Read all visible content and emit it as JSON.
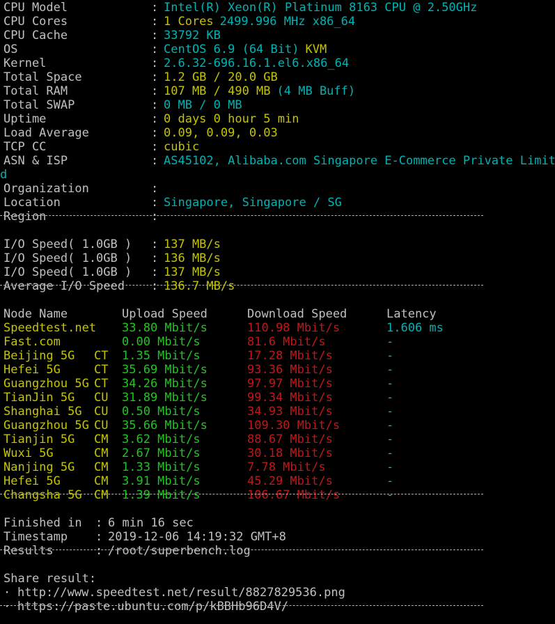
{
  "colors": {
    "background": "#000000",
    "label_text": "#c0c0c0",
    "cyan": "#00b3b3",
    "yellow": "#c4c400",
    "green": "#22c322",
    "red": "#c01818"
  },
  "system_info": [
    {
      "label": "CPU Model",
      "sep": ":",
      "value": "Intel(R) Xeon(R) Platinum 8163 CPU @ 2.50GHz",
      "color": "cy"
    },
    {
      "label": "CPU Cores",
      "sep": ":",
      "value": "1 Cores",
      "value2": "2499.996 MHz x86_64",
      "color": "yl",
      "color2": "cy"
    },
    {
      "label": "CPU Cache",
      "sep": ":",
      "value": "33792 KB",
      "color": "cy"
    },
    {
      "label": "OS",
      "sep": ":",
      "value": "CentOS 6.9 (64 Bit)",
      "value2": "KVM",
      "color": "cy",
      "color2": "yl"
    },
    {
      "label": "Kernel",
      "sep": ":",
      "value": "2.6.32-696.16.1.el6.x86_64",
      "color": "cy"
    },
    {
      "label": "Total Space",
      "sep": ":",
      "value": "1.2 GB / 20.0 GB",
      "color": "yl"
    },
    {
      "label": "Total RAM",
      "sep": ":",
      "value": "107 MB / 490 MB",
      "value2": "(4 MB Buff)",
      "color": "yl",
      "color2": "cy"
    },
    {
      "label": "Total SWAP",
      "sep": ":",
      "value": "0 MB / 0 MB",
      "color": "cy"
    },
    {
      "label": "Uptime",
      "sep": ":",
      "value": "0 days 0 hour 5 min",
      "color": "yl"
    },
    {
      "label": "Load Average",
      "sep": ":",
      "value": "0.09, 0.09, 0.03",
      "color": "yl"
    },
    {
      "label": "TCP CC",
      "sep": ":",
      "value": "cubic",
      "color": "yl"
    },
    {
      "label": "ASN & ISP",
      "sep": ":",
      "value": "AS45102, Alibaba.com Singapore E-Commerce Private Limite",
      "color": "cy"
    }
  ],
  "wrap_char": "d",
  "location_info": [
    {
      "label": "Organization",
      "sep": ":",
      "value": ""
    },
    {
      "label": "Location",
      "sep": ":",
      "value": "Singapore, Singapore / SG",
      "color": "cy"
    },
    {
      "label": "Region",
      "sep": ":",
      "value": ""
    }
  ],
  "io_speed": [
    {
      "label": "I/O Speed( 1.0GB )",
      "sep": ":",
      "value": "137 MB/s"
    },
    {
      "label": "I/O Speed( 1.0GB )",
      "sep": ":",
      "value": "136 MB/s"
    },
    {
      "label": "I/O Speed( 1.0GB )",
      "sep": ":",
      "value": "137 MB/s"
    },
    {
      "label": "Average I/O Speed",
      "sep": ":",
      "value": "136.7 MB/s"
    }
  ],
  "speed_table": {
    "headers": [
      "Node Name",
      "Upload Speed",
      "Download Speed",
      "Latency"
    ],
    "rows": [
      {
        "node": "Speedtest.net",
        "isp": "",
        "upload": "33.80 Mbit/s",
        "download": "110.98 Mbit/s",
        "latency": "1.606 ms",
        "node_color": "yl"
      },
      {
        "node": "Fast.com",
        "isp": "",
        "upload": "0.00 Mbit/s",
        "download": "81.6 Mbit/s",
        "latency": "-",
        "node_color": "yl"
      },
      {
        "node": "Beijing 5G",
        "isp": "CT",
        "upload": "1.35 Mbit/s",
        "download": "17.28 Mbit/s",
        "latency": "-",
        "node_color": "yl"
      },
      {
        "node": "Hefei 5G",
        "isp": "CT",
        "upload": "35.69 Mbit/s",
        "download": "93.36 Mbit/s",
        "latency": "-",
        "node_color": "yl"
      },
      {
        "node": "Guangzhou 5G",
        "isp": "CT",
        "upload": "34.26 Mbit/s",
        "download": "97.97 Mbit/s",
        "latency": "-",
        "node_color": "yl"
      },
      {
        "node": "TianJin 5G",
        "isp": "CU",
        "upload": "31.89 Mbit/s",
        "download": "99.34 Mbit/s",
        "latency": "-",
        "node_color": "yl"
      },
      {
        "node": "Shanghai 5G",
        "isp": "CU",
        "upload": "0.50 Mbit/s",
        "download": "34.93 Mbit/s",
        "latency": "-",
        "node_color": "yl"
      },
      {
        "node": "Guangzhou 5G",
        "isp": "CU",
        "upload": "35.66 Mbit/s",
        "download": "109.30 Mbit/s",
        "latency": "-",
        "node_color": "yl"
      },
      {
        "node": "Tianjin 5G",
        "isp": "CM",
        "upload": "3.62 Mbit/s",
        "download": "88.67 Mbit/s",
        "latency": "-",
        "node_color": "yl"
      },
      {
        "node": "Wuxi 5G",
        "isp": "CM",
        "upload": "2.67 Mbit/s",
        "download": "30.18 Mbit/s",
        "latency": "-",
        "node_color": "yl"
      },
      {
        "node": "Nanjing 5G",
        "isp": "CM",
        "upload": "1.33 Mbit/s",
        "download": "7.78 Mbit/s",
        "latency": "-",
        "node_color": "yl"
      },
      {
        "node": "Hefei 5G",
        "isp": "CM",
        "upload": "3.91 Mbit/s",
        "download": "45.29 Mbit/s",
        "latency": "-",
        "node_color": "yl"
      },
      {
        "node": "Changsha 5G",
        "isp": "CM",
        "upload": "1.39 Mbit/s",
        "download": "106.67 Mbit/s",
        "latency": "-",
        "node_color": "yl"
      }
    ]
  },
  "summary": [
    {
      "label": "Finished in",
      "sep": ":",
      "value": "6 min 16 sec"
    },
    {
      "label": "Timestamp",
      "sep": ":",
      "value": "2019-12-06 14:19:32 GMT+8"
    },
    {
      "label": "Results",
      "sep": ":",
      "value": "/root/superbench.log"
    }
  ],
  "share": {
    "title": "Share result:",
    "bullet": "·",
    "links": [
      "http://www.speedtest.net/result/8827829536.png",
      "https://paste.ubuntu.com/p/kBBHb96D4V/"
    ]
  }
}
